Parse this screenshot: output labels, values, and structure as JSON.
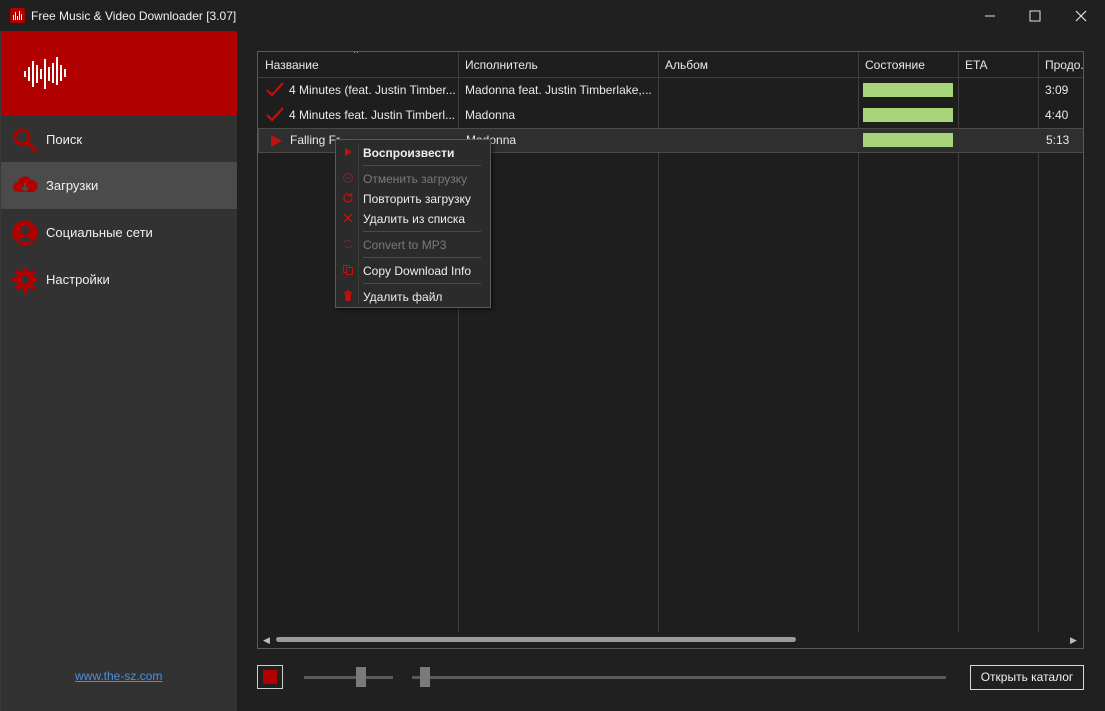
{
  "window": {
    "title": "Free Music & Video Downloader [3.07]",
    "controls": [
      "minimize",
      "maximize",
      "close"
    ]
  },
  "colors": {
    "brand": "#b00000",
    "sidebar_bg": "#323232",
    "active_nav_bg": "#4b4b4b",
    "progress_complete": "#a8d57a",
    "link": "#4a8fdd"
  },
  "sidebar": {
    "items": [
      {
        "label": "Поиск",
        "icon": "search-icon",
        "active": false
      },
      {
        "label": "Загрузки",
        "icon": "cloud-download-icon",
        "active": true
      },
      {
        "label": "Социальные сети",
        "icon": "user-icon",
        "active": false
      },
      {
        "label": "Настройки",
        "icon": "gear-icon",
        "active": false
      }
    ],
    "footer_link": "www.the-sz.com"
  },
  "table": {
    "columns": [
      "Название",
      "Исполнитель",
      "Альбом",
      "Состояние",
      "ETA",
      "Продо..."
    ],
    "sorted_column": "Название",
    "rows": [
      {
        "status_icon": "check-icon",
        "name": "4 Minutes (feat. Justin Timber...",
        "artist": "Madonna feat. Justin Timberlake,...",
        "album": "",
        "progress": 1.0,
        "eta": "",
        "duration": "3:09",
        "selected": false
      },
      {
        "status_icon": "check-icon",
        "name": "4 Minutes feat. Justin Timberl...",
        "artist": "Madonna",
        "album": "",
        "progress": 1.0,
        "eta": "",
        "duration": "4:40",
        "selected": false
      },
      {
        "status_icon": "play-icon",
        "name": "Falling Fr",
        "artist": "Madonna",
        "album": "",
        "progress": 1.0,
        "eta": "",
        "duration": "5:13",
        "selected": true
      }
    ]
  },
  "context_menu": {
    "items": [
      {
        "label": "Воспроизвести",
        "icon": "play-icon",
        "disabled": false,
        "bold": true
      },
      {
        "label": "Отменить загрузку",
        "icon": "cancel-icon",
        "disabled": true,
        "bold": false
      },
      {
        "label": "Повторить загрузку",
        "icon": "refresh-icon",
        "disabled": false,
        "bold": false
      },
      {
        "label": "Удалить из списка",
        "icon": "x-icon",
        "disabled": false,
        "bold": false
      },
      {
        "label": "Convert to MP3",
        "icon": "convert-icon",
        "disabled": true,
        "bold": false
      },
      {
        "label": "Copy Download Info",
        "icon": "copy-icon",
        "disabled": false,
        "bold": false
      },
      {
        "label": "Удалить файл",
        "icon": "trash-icon",
        "disabled": false,
        "bold": false
      }
    ]
  },
  "bottom_bar": {
    "open_folder_label": "Открыть каталог",
    "volume_level": 0.63,
    "seek_position": 0.02
  }
}
